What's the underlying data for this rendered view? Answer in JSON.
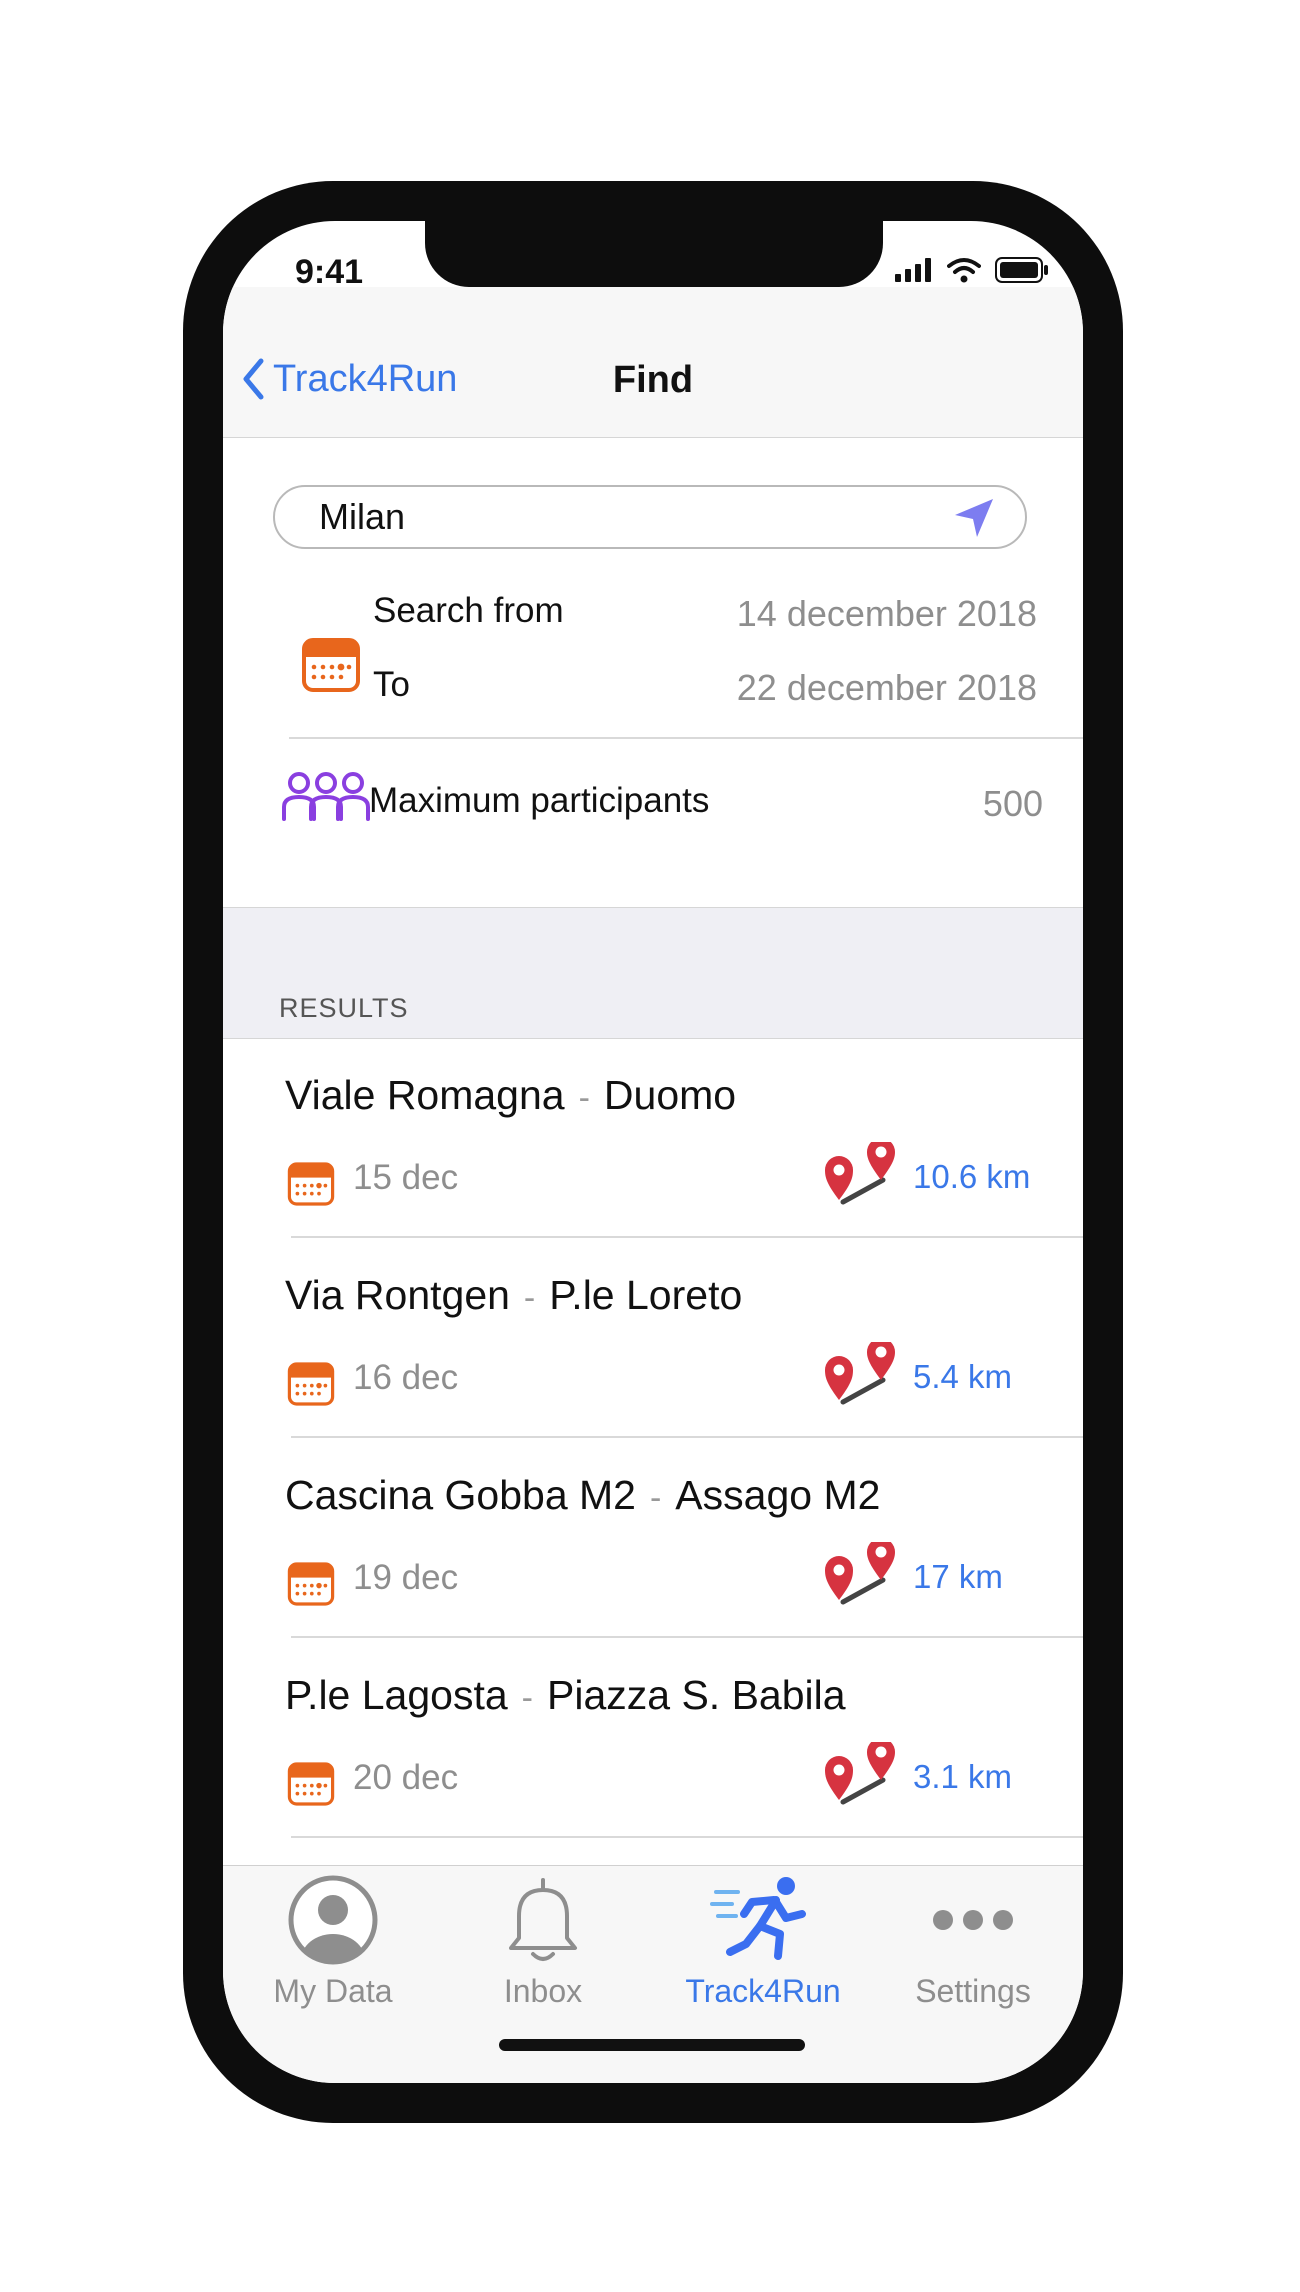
{
  "status": {
    "time": "9:41"
  },
  "nav": {
    "back_label": "Track4Run",
    "title": "Find"
  },
  "search": {
    "value": "Milan"
  },
  "dates": {
    "from_label": "Search from",
    "from_value": "14 december 2018",
    "to_label": "To",
    "to_value": "22 december 2018"
  },
  "participants": {
    "label": "Maximum participants",
    "value": "500"
  },
  "section_header": "RESULTS",
  "results": [
    {
      "from": "Viale Romagna",
      "to": "Duomo",
      "date": "15 dec",
      "distance": "10.6 km"
    },
    {
      "from": "Via Rontgen",
      "to": "P.le Loreto",
      "date": "16 dec",
      "distance": "5.4 km"
    },
    {
      "from": "Cascina Gobba M2",
      "to": "Assago M2",
      "date": "19 dec",
      "distance": "17 km"
    },
    {
      "from": "P.le Lagosta",
      "to": "Piazza S. Babila",
      "date": "20 dec",
      "distance": "3.1 km"
    }
  ],
  "separator": "-",
  "tabs": [
    {
      "label": "My Data",
      "icon": "person-circle-icon"
    },
    {
      "label": "Inbox",
      "icon": "bell-icon"
    },
    {
      "label": "Track4Run",
      "icon": "runner-icon",
      "active": true
    },
    {
      "label": "Settings",
      "icon": "more-dots-icon"
    }
  ],
  "colors": {
    "accent": "#3a78e8",
    "calendar": "#e8661c",
    "participants": "#8a3fe0",
    "pin": "#d63340",
    "section_bg": "#efeff4"
  }
}
